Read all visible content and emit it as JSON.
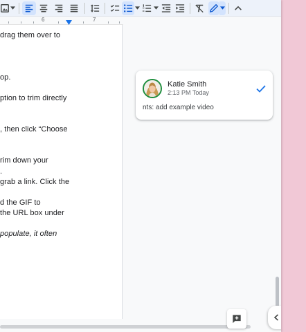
{
  "toolbar": {
    "buttons": [
      "insert-image",
      "align-left",
      "align-center",
      "align-right",
      "justify",
      "line-spacing",
      "checklist",
      "bulleted-list",
      "numbered-list",
      "decrease-indent",
      "increase-indent",
      "clear-formatting",
      "editing-mode",
      "collapse-toolbar"
    ],
    "active": [
      "align-left",
      "bulleted-list",
      "editing-mode"
    ]
  },
  "ruler": {
    "marks": [
      "6",
      "7"
    ]
  },
  "document": {
    "lines": [
      "drag them over to",
      "op.",
      "ption to trim directly",
      ", then click “Choose",
      "rim down your",
      ".",
      "grab a link. Click the",
      "d the GIF to",
      "the URL box under",
      "populate, it often"
    ]
  },
  "comment": {
    "author": "Katie Smith",
    "time": "2:13 PM Today",
    "text": "nts: add example video"
  },
  "colors": {
    "accent": "#1a73e8",
    "toolbar_bg": "#edf2fa",
    "active_bg": "#d3e3fd",
    "desktop_bg": "#f1c8d6",
    "avatar_ring": "#1e8e3e"
  }
}
